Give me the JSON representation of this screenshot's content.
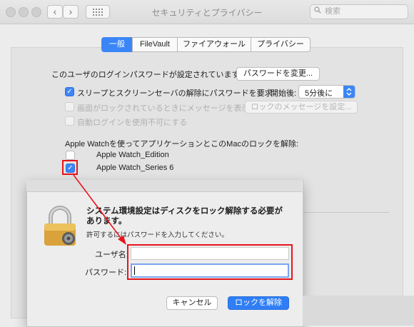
{
  "window": {
    "title": "セキュリティとプライバシー",
    "search_placeholder": "検索"
  },
  "tabs": [
    {
      "label": "一般",
      "selected": true
    },
    {
      "label": "FileVault",
      "selected": false
    },
    {
      "label": "ファイアウォール",
      "selected": false
    },
    {
      "label": "プライバシー",
      "selected": false
    }
  ],
  "general": {
    "password_set_text": "このユーザのログインパスワードが設定されています",
    "change_password_button": "パスワードを変更...",
    "require_password_label": "スリープとスクリーンセーバの解除にパスワードを要求",
    "require_password_checked": true,
    "start_after_label": "開始後:",
    "start_after_value": "5分後に",
    "show_message_label": "画面がロックされているときにメッセージを表示",
    "show_message_checked": false,
    "set_lock_message_button": "ロックのメッセージを設定...",
    "disable_autologin_label": "自動ログインを使用不可にする",
    "disable_autologin_checked": false,
    "apple_watch_heading": "Apple Watchを使ってアプリケーションとこのMacのロックを解除:",
    "watches": [
      {
        "name": "Apple Watch_Edition",
        "checked": false
      },
      {
        "name": "Apple Watch_Series 6",
        "checked": true
      }
    ]
  },
  "dialog": {
    "title": "システム環境設定はディスクをロック解除する必要があります。",
    "subtitle": "許可するにはパスワードを入力してください。",
    "username_label": "ユーザ名:",
    "username_value": "",
    "password_label": "パスワード:",
    "password_value": "",
    "cancel_button": "キャンセル",
    "unlock_button": "ロックを解除"
  },
  "colors": {
    "accent": "#3b86f7",
    "annotation": "#e8141b"
  }
}
